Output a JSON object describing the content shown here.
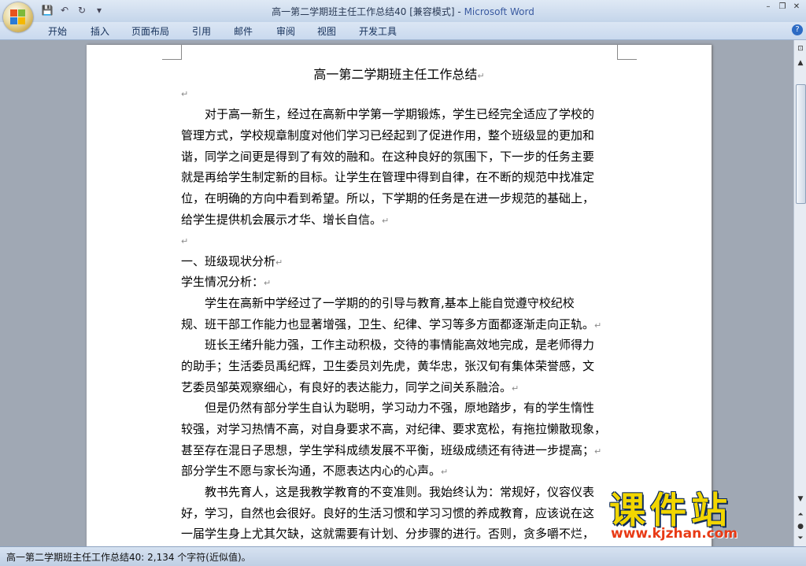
{
  "window": {
    "title_doc": "高一第二学期班主任工作总结40 [兼容模式] - ",
    "title_app": "Microsoft Word",
    "controls": [
      "–",
      "❐",
      "✕"
    ]
  },
  "qat": {
    "save": "💾",
    "undo": "↶",
    "redo": "↻",
    "more": "▾"
  },
  "ribbon": {
    "tabs": [
      "开始",
      "插入",
      "页面布局",
      "引用",
      "邮件",
      "审阅",
      "视图",
      "开发工具"
    ],
    "help": "?"
  },
  "document": {
    "title": "高一第二学期班主任工作总结",
    "para_mark": "↵",
    "lines": [
      "",
      "　　对于高一新生，经过在高新中学第一学期锻炼，学生已经完全适应了学校的",
      "管理方式，学校规章制度对他们学习已经起到了促进作用，整个班级显的更加和",
      "谐，同学之间更是得到了有效的融和。在这种良好的氛围下，下一步的任务主要",
      "就是再给学生制定新的目标。让学生在管理中得到自律，在不断的规范中找准定",
      "位，在明确的方向中看到希望。所以，下学期的任务是在进一步规范的基础上，",
      "给学生提供机会展示才华、增长自信。",
      " ",
      "一、班级现状分析",
      "学生情况分析：",
      "　　学生在高新中学经过了一学期的的引导与教育,基本上能自觉遵守校纪校",
      "规、班干部工作能力也显著增强，卫生、纪律、学习等多方面都逐渐走向正轨。",
      "　　班长王绪升能力强，工作主动积极，交待的事情能高效地完成，是老师得力",
      "的助手；生活委员禹纪辉，卫生委员刘先虎，黄华忠，张汉旬有集体荣誉感，文",
      "艺委员邹英观察细心，有良好的表达能力，同学之间关系融洽。",
      "　　但是仍然有部分学生自认为聪明，学习动力不强，原地踏步，有的学生惰性",
      "较强，对学习热情不高，对自身要求不高，对纪律、要求宽松，有拖拉懒散现象，",
      "甚至存在混日子思想，学生学科成绩发展不平衡，班级成绩还有待进一步提高；",
      "部分学生不愿与家长沟通，不愿表达内心的心声。",
      "　　教书先育人，这是我教学教育的不变准则。我始终认为：常规好，仪容仪表",
      "好，学习，自然也会很好。良好的生活习惯和学习习惯的养成教育，应该说在这",
      "一届学生身上尤其欠缺，这就需要有计划、分步骤的进行。否则，贪多嚼不烂，"
    ]
  },
  "scrollbar": {
    "up": "▲",
    "down": "▼",
    "prev": "⏶",
    "browse": "●",
    "next": "⏷",
    "split": "⊡"
  },
  "status": {
    "text": "高一第二学期班主任工作总结40: 2,134 个字符(近似值)。"
  },
  "watermark": {
    "cn": "课件站",
    "url": "www.kjzhan.com"
  },
  "colors": {
    "accent": "#3a5aa0",
    "watermark_yellow": "#f2d600",
    "watermark_red": "#e83a15"
  }
}
